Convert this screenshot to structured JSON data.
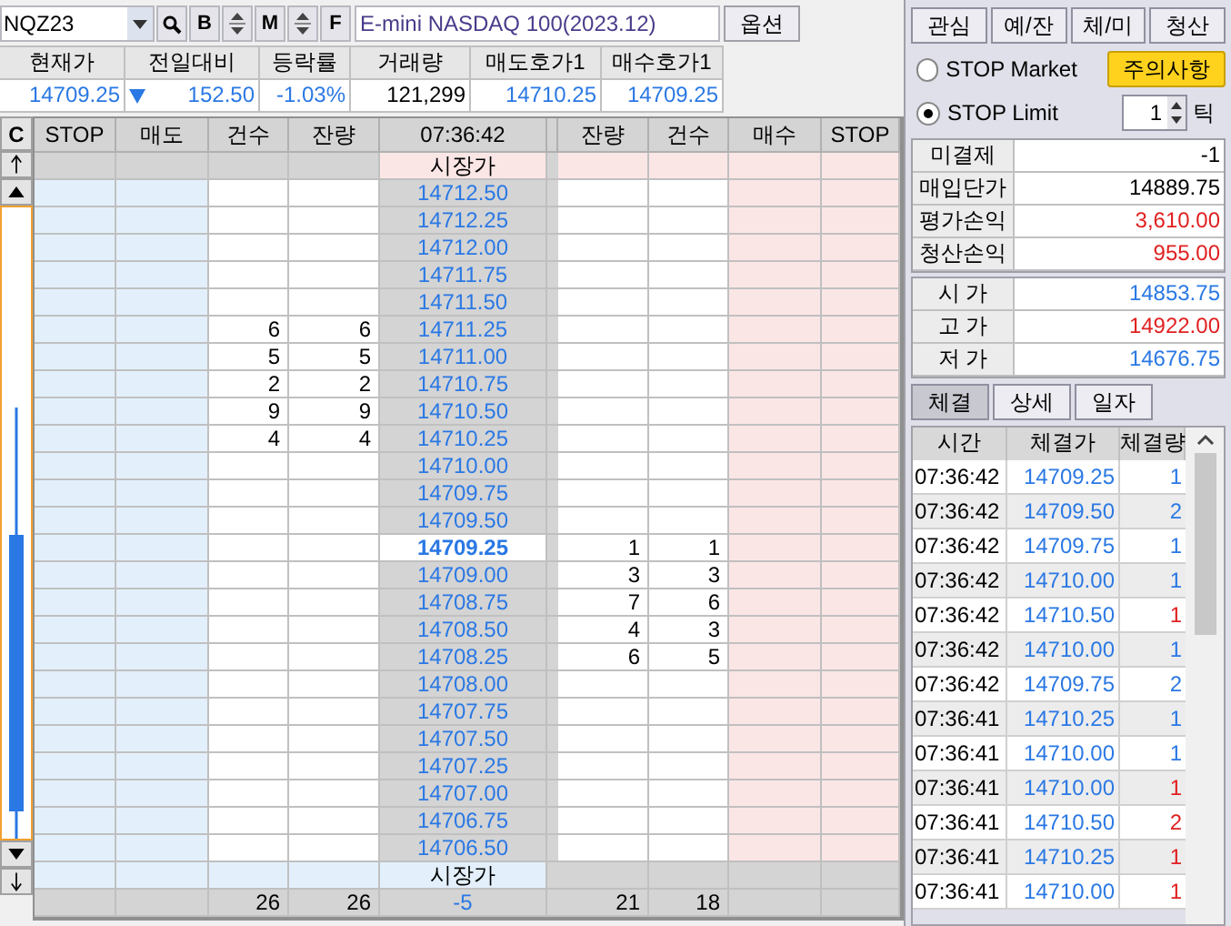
{
  "symbol": {
    "code": "NQZ23",
    "name": "E-mini NASDAQ 100(2023.12)",
    "option_button": "옵션"
  },
  "toolbar": [
    {
      "kind": "search"
    },
    {
      "kind": "letter",
      "label": "B"
    },
    {
      "kind": "spin"
    },
    {
      "kind": "letter",
      "label": "M"
    },
    {
      "kind": "spin"
    },
    {
      "kind": "letter",
      "label": "F"
    }
  ],
  "quote": {
    "columns": [
      "현재가",
      "전일대비",
      "등락률",
      "거래량",
      "매도호가1",
      "매수호가1"
    ],
    "values": [
      "14709.25",
      "152.50",
      "-1.03%",
      "121,299",
      "14710.25",
      "14709.25"
    ],
    "falling": true
  },
  "ladder": {
    "corner": "C",
    "columns": [
      "STOP",
      "매도",
      "건수",
      "잔량",
      "07:36:42",
      "잔량",
      "건수",
      "매수",
      "STOP"
    ],
    "market_top": "시장가",
    "market_bottom": "시장가",
    "rows": [
      {
        "price": "14712.50",
        "current": false
      },
      {
        "price": "14712.25",
        "current": false
      },
      {
        "price": "14712.00",
        "current": false
      },
      {
        "price": "14711.75",
        "current": false
      },
      {
        "price": "14711.50",
        "current": false
      },
      {
        "price": "14711.25",
        "current": false,
        "ask_count": "6",
        "ask_qty": "6"
      },
      {
        "price": "14711.00",
        "current": false,
        "ask_count": "5",
        "ask_qty": "5"
      },
      {
        "price": "14710.75",
        "current": false,
        "ask_count": "2",
        "ask_qty": "2"
      },
      {
        "price": "14710.50",
        "current": false,
        "ask_count": "9",
        "ask_qty": "9"
      },
      {
        "price": "14710.25",
        "current": false,
        "ask_count": "4",
        "ask_qty": "4"
      },
      {
        "price": "14710.00",
        "current": false
      },
      {
        "price": "14709.75",
        "current": false
      },
      {
        "price": "14709.50",
        "current": false
      },
      {
        "price": "14709.25",
        "current": true,
        "bid_qty": "1",
        "bid_count": "1"
      },
      {
        "price": "14709.00",
        "current": false,
        "bid_qty": "3",
        "bid_count": "3"
      },
      {
        "price": "14708.75",
        "current": false,
        "bid_qty": "7",
        "bid_count": "6"
      },
      {
        "price": "14708.50",
        "current": false,
        "bid_qty": "4",
        "bid_count": "3"
      },
      {
        "price": "14708.25",
        "current": false,
        "bid_qty": "6",
        "bid_count": "5"
      },
      {
        "price": "14708.00",
        "current": false
      },
      {
        "price": "14707.75",
        "current": false
      },
      {
        "price": "14707.50",
        "current": false
      },
      {
        "price": "14707.25",
        "current": false
      },
      {
        "price": "14707.00",
        "current": false
      },
      {
        "price": "14706.75",
        "current": false
      },
      {
        "price": "14706.50",
        "current": false
      }
    ],
    "totals": {
      "ask_count": "26",
      "ask_qty": "26",
      "net": "-5",
      "bid_qty": "21",
      "bid_count": "18"
    }
  },
  "side_buttons": [
    "관심",
    "예/잔",
    "체/미",
    "청산"
  ],
  "stop_options": [
    {
      "label": "STOP Market",
      "selected": false
    },
    {
      "label": "STOP Limit",
      "selected": true
    }
  ],
  "notice_button": "주의사항",
  "tick": {
    "value": "1",
    "unit": "틱"
  },
  "position": [
    {
      "label": "미결제",
      "value": "-1",
      "color": "#000000"
    },
    {
      "label": "매입단가",
      "value": "14889.75",
      "color": "#000000"
    },
    {
      "label": "평가손익",
      "value": "3,610.00",
      "color": "#e02020"
    },
    {
      "label": "청산손익",
      "value": "955.00",
      "color": "#e02020"
    }
  ],
  "prices": [
    {
      "label": "시 가",
      "value": "14853.75",
      "color": "#2a78e4"
    },
    {
      "label": "고 가",
      "value": "14922.00",
      "color": "#e02020"
    },
    {
      "label": "저 가",
      "value": "14676.75",
      "color": "#2a78e4"
    }
  ],
  "tabs": [
    {
      "label": "체결",
      "selected": true
    },
    {
      "label": "상세",
      "selected": false
    },
    {
      "label": "일자",
      "selected": false
    }
  ],
  "trades": {
    "columns": [
      "시간",
      "체결가",
      "체결량"
    ],
    "rows": [
      {
        "time": "07:36:42",
        "price": "14709.25",
        "qty": "1",
        "color": "#2a78e4"
      },
      {
        "time": "07:36:42",
        "price": "14709.50",
        "qty": "2",
        "color": "#2a78e4"
      },
      {
        "time": "07:36:42",
        "price": "14709.75",
        "qty": "1",
        "color": "#2a78e4"
      },
      {
        "time": "07:36:42",
        "price": "14710.00",
        "qty": "1",
        "color": "#2a78e4"
      },
      {
        "time": "07:36:42",
        "price": "14710.50",
        "qty": "1",
        "color": "#e02020"
      },
      {
        "time": "07:36:42",
        "price": "14710.00",
        "qty": "1",
        "color": "#2a78e4"
      },
      {
        "time": "07:36:42",
        "price": "14709.75",
        "qty": "2",
        "color": "#2a78e4"
      },
      {
        "time": "07:36:41",
        "price": "14710.25",
        "qty": "1",
        "color": "#2a78e4"
      },
      {
        "time": "07:36:41",
        "price": "14710.00",
        "qty": "1",
        "color": "#2a78e4"
      },
      {
        "time": "07:36:41",
        "price": "14710.00",
        "qty": "1",
        "color": "#e02020"
      },
      {
        "time": "07:36:41",
        "price": "14710.50",
        "qty": "2",
        "color": "#e02020"
      },
      {
        "time": "07:36:41",
        "price": "14710.25",
        "qty": "1",
        "color": "#e02020"
      },
      {
        "time": "07:36:41",
        "price": "14710.00",
        "qty": "1",
        "color": "#e02020"
      }
    ]
  }
}
